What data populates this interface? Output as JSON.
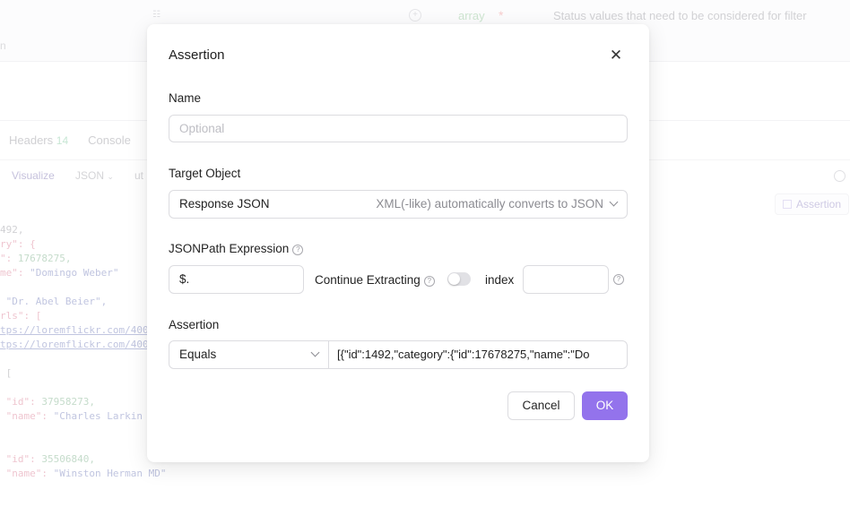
{
  "background": {
    "param_type": "array",
    "required_mark": "*",
    "param_description": "Status values that need to be considered for filter",
    "param_name_fragment": "n",
    "tabs": [
      {
        "label": "Headers",
        "count": "14"
      },
      {
        "label": "Console",
        "count": ""
      }
    ],
    "view_mode": "Visualize",
    "format": "JSON",
    "format2": "ut",
    "assertion_button": "Assertion",
    "code_lines": [
      {
        "t": "492,"
      },
      {
        "k": "ry\": {"
      },
      {
        "k": "\": ",
        "n": "17678275,"
      },
      {
        "k": "me\": ",
        "s": "\"Domingo Weber\""
      },
      {
        "t": ""
      },
      {
        "k": " ",
        "s": "\"Dr. Abel Beier\","
      },
      {
        "k": "rls\": ["
      },
      {
        "u": "tps://loremflickr.com/400"
      },
      {
        "u": "tps://loremflickr.com/400"
      },
      {
        "t": ""
      },
      {
        "t": " ["
      },
      {
        "t": ""
      },
      {
        "k": " \"id\": ",
        "n": "37958273,"
      },
      {
        "k": " \"name\": ",
        "s": "\"Charles Larkin"
      },
      {
        "t": ""
      },
      {
        "t": ""
      },
      {
        "k": " \"id\": ",
        "n": "35506840,"
      },
      {
        "k": " \"name\": ",
        "s": "\"Winston Herman MD\""
      }
    ]
  },
  "dialog": {
    "title": "Assertion",
    "close_icon": "close-icon",
    "name": {
      "label": "Name",
      "value": "",
      "placeholder": "Optional"
    },
    "target": {
      "label": "Target Object",
      "value": "Response JSON",
      "hint": "XML(-like) automatically converts to JSON"
    },
    "jsonpath": {
      "label": "JSONPath Expression",
      "value": "$.",
      "continue_label": "Continue Extracting",
      "continue_enabled": false,
      "index_label": "index",
      "index_value": ""
    },
    "assertion": {
      "label": "Assertion",
      "operator": "Equals",
      "value": "[{\"id\":1492,\"category\":{\"id\":17678275,\"name\":\"Do"
    },
    "cancel_label": "Cancel",
    "ok_label": "OK",
    "colors": {
      "primary": "#9373ec",
      "border": "#dcdce0",
      "overlay": "#ffffff"
    }
  }
}
